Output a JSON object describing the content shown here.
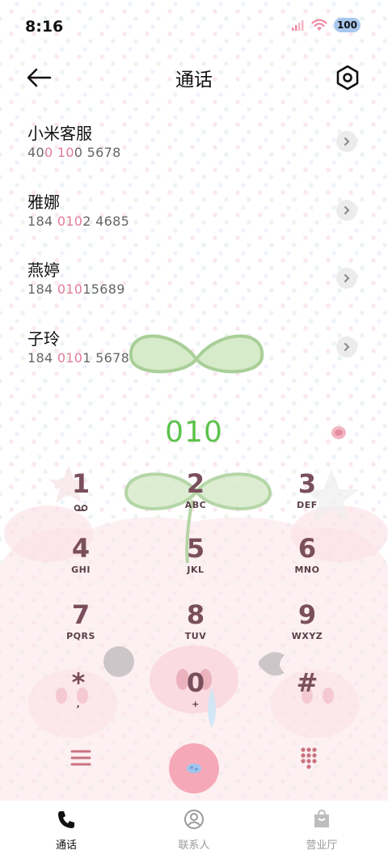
{
  "status_bar": {
    "time": "8:16",
    "battery": "100"
  },
  "header": {
    "title": "通话"
  },
  "calls": [
    {
      "name": "小米客服",
      "number_parts": [
        "40",
        "0 10",
        "0 5678"
      ]
    },
    {
      "name": "雅娜",
      "number_parts": [
        "184 ",
        "010",
        "2 4685"
      ]
    },
    {
      "name": "燕婷",
      "number_parts": [
        "184 ",
        "010",
        "15689"
      ]
    },
    {
      "name": "子玲",
      "number_parts": [
        "184 ",
        "010",
        "1 5678"
      ]
    }
  ],
  "dial": {
    "number": "010",
    "color": "#5cc24c"
  },
  "keypad": [
    {
      "digit": "1",
      "letters": ""
    },
    {
      "digit": "2",
      "letters": "ABC"
    },
    {
      "digit": "3",
      "letters": "DEF"
    },
    {
      "digit": "4",
      "letters": "GHI"
    },
    {
      "digit": "5",
      "letters": "JKL"
    },
    {
      "digit": "6",
      "letters": "MNO"
    },
    {
      "digit": "7",
      "letters": "PQRS"
    },
    {
      "digit": "8",
      "letters": "TUV"
    },
    {
      "digit": "9",
      "letters": "WXYZ"
    },
    {
      "digit": "*",
      "letters": ","
    },
    {
      "digit": "0",
      "letters": "+"
    },
    {
      "digit": "#",
      "letters": ""
    }
  ],
  "nav": [
    {
      "label": "通话",
      "icon": "phone-icon",
      "active": true
    },
    {
      "label": "联系人",
      "icon": "contact-icon",
      "active": false
    },
    {
      "label": "营业厅",
      "icon": "store-icon",
      "active": false
    }
  ],
  "colors": {
    "accent_pink": "#e27b9a",
    "call_button": "#f5a9b8",
    "key_digit": "#7a4f5c"
  }
}
